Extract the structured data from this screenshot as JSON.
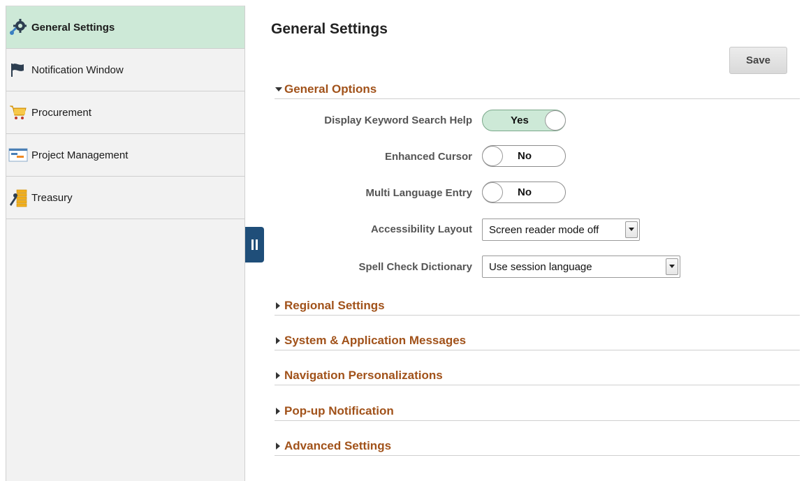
{
  "sidebar": {
    "items": [
      {
        "label": "General Settings",
        "icon": "wrench-gear-icon",
        "active": true
      },
      {
        "label": "Notification Window",
        "icon": "flag-icon",
        "active": false
      },
      {
        "label": "Procurement",
        "icon": "shopping-cart-icon",
        "active": false
      },
      {
        "label": "Project Management",
        "icon": "gantt-chart-icon",
        "active": false
      },
      {
        "label": "Treasury",
        "icon": "treasury-icon",
        "active": false
      }
    ]
  },
  "main": {
    "title": "General Settings",
    "save_label": "Save",
    "general_options": {
      "heading": "General Options",
      "expanded": true,
      "fields": {
        "keyword_search_help": {
          "label": "Display Keyword Search Help",
          "value": "Yes"
        },
        "enhanced_cursor": {
          "label": "Enhanced Cursor",
          "value": "No"
        },
        "multi_language_entry": {
          "label": "Multi Language Entry",
          "value": "No"
        },
        "accessibility_layout": {
          "label": "Accessibility Layout",
          "value": "Screen reader mode off"
        },
        "spell_check_dictionary": {
          "label": "Spell Check Dictionary",
          "value": "Use session language"
        }
      }
    },
    "collapsed_sections": [
      "Regional Settings",
      "System & Application Messages",
      "Navigation Personalizations",
      "Pop-up Notification",
      "Advanced Settings"
    ]
  },
  "colors": {
    "active_item_bg": "#cde9d7",
    "section_heading": "#a1521a",
    "collapse_handle": "#1f4e79"
  }
}
